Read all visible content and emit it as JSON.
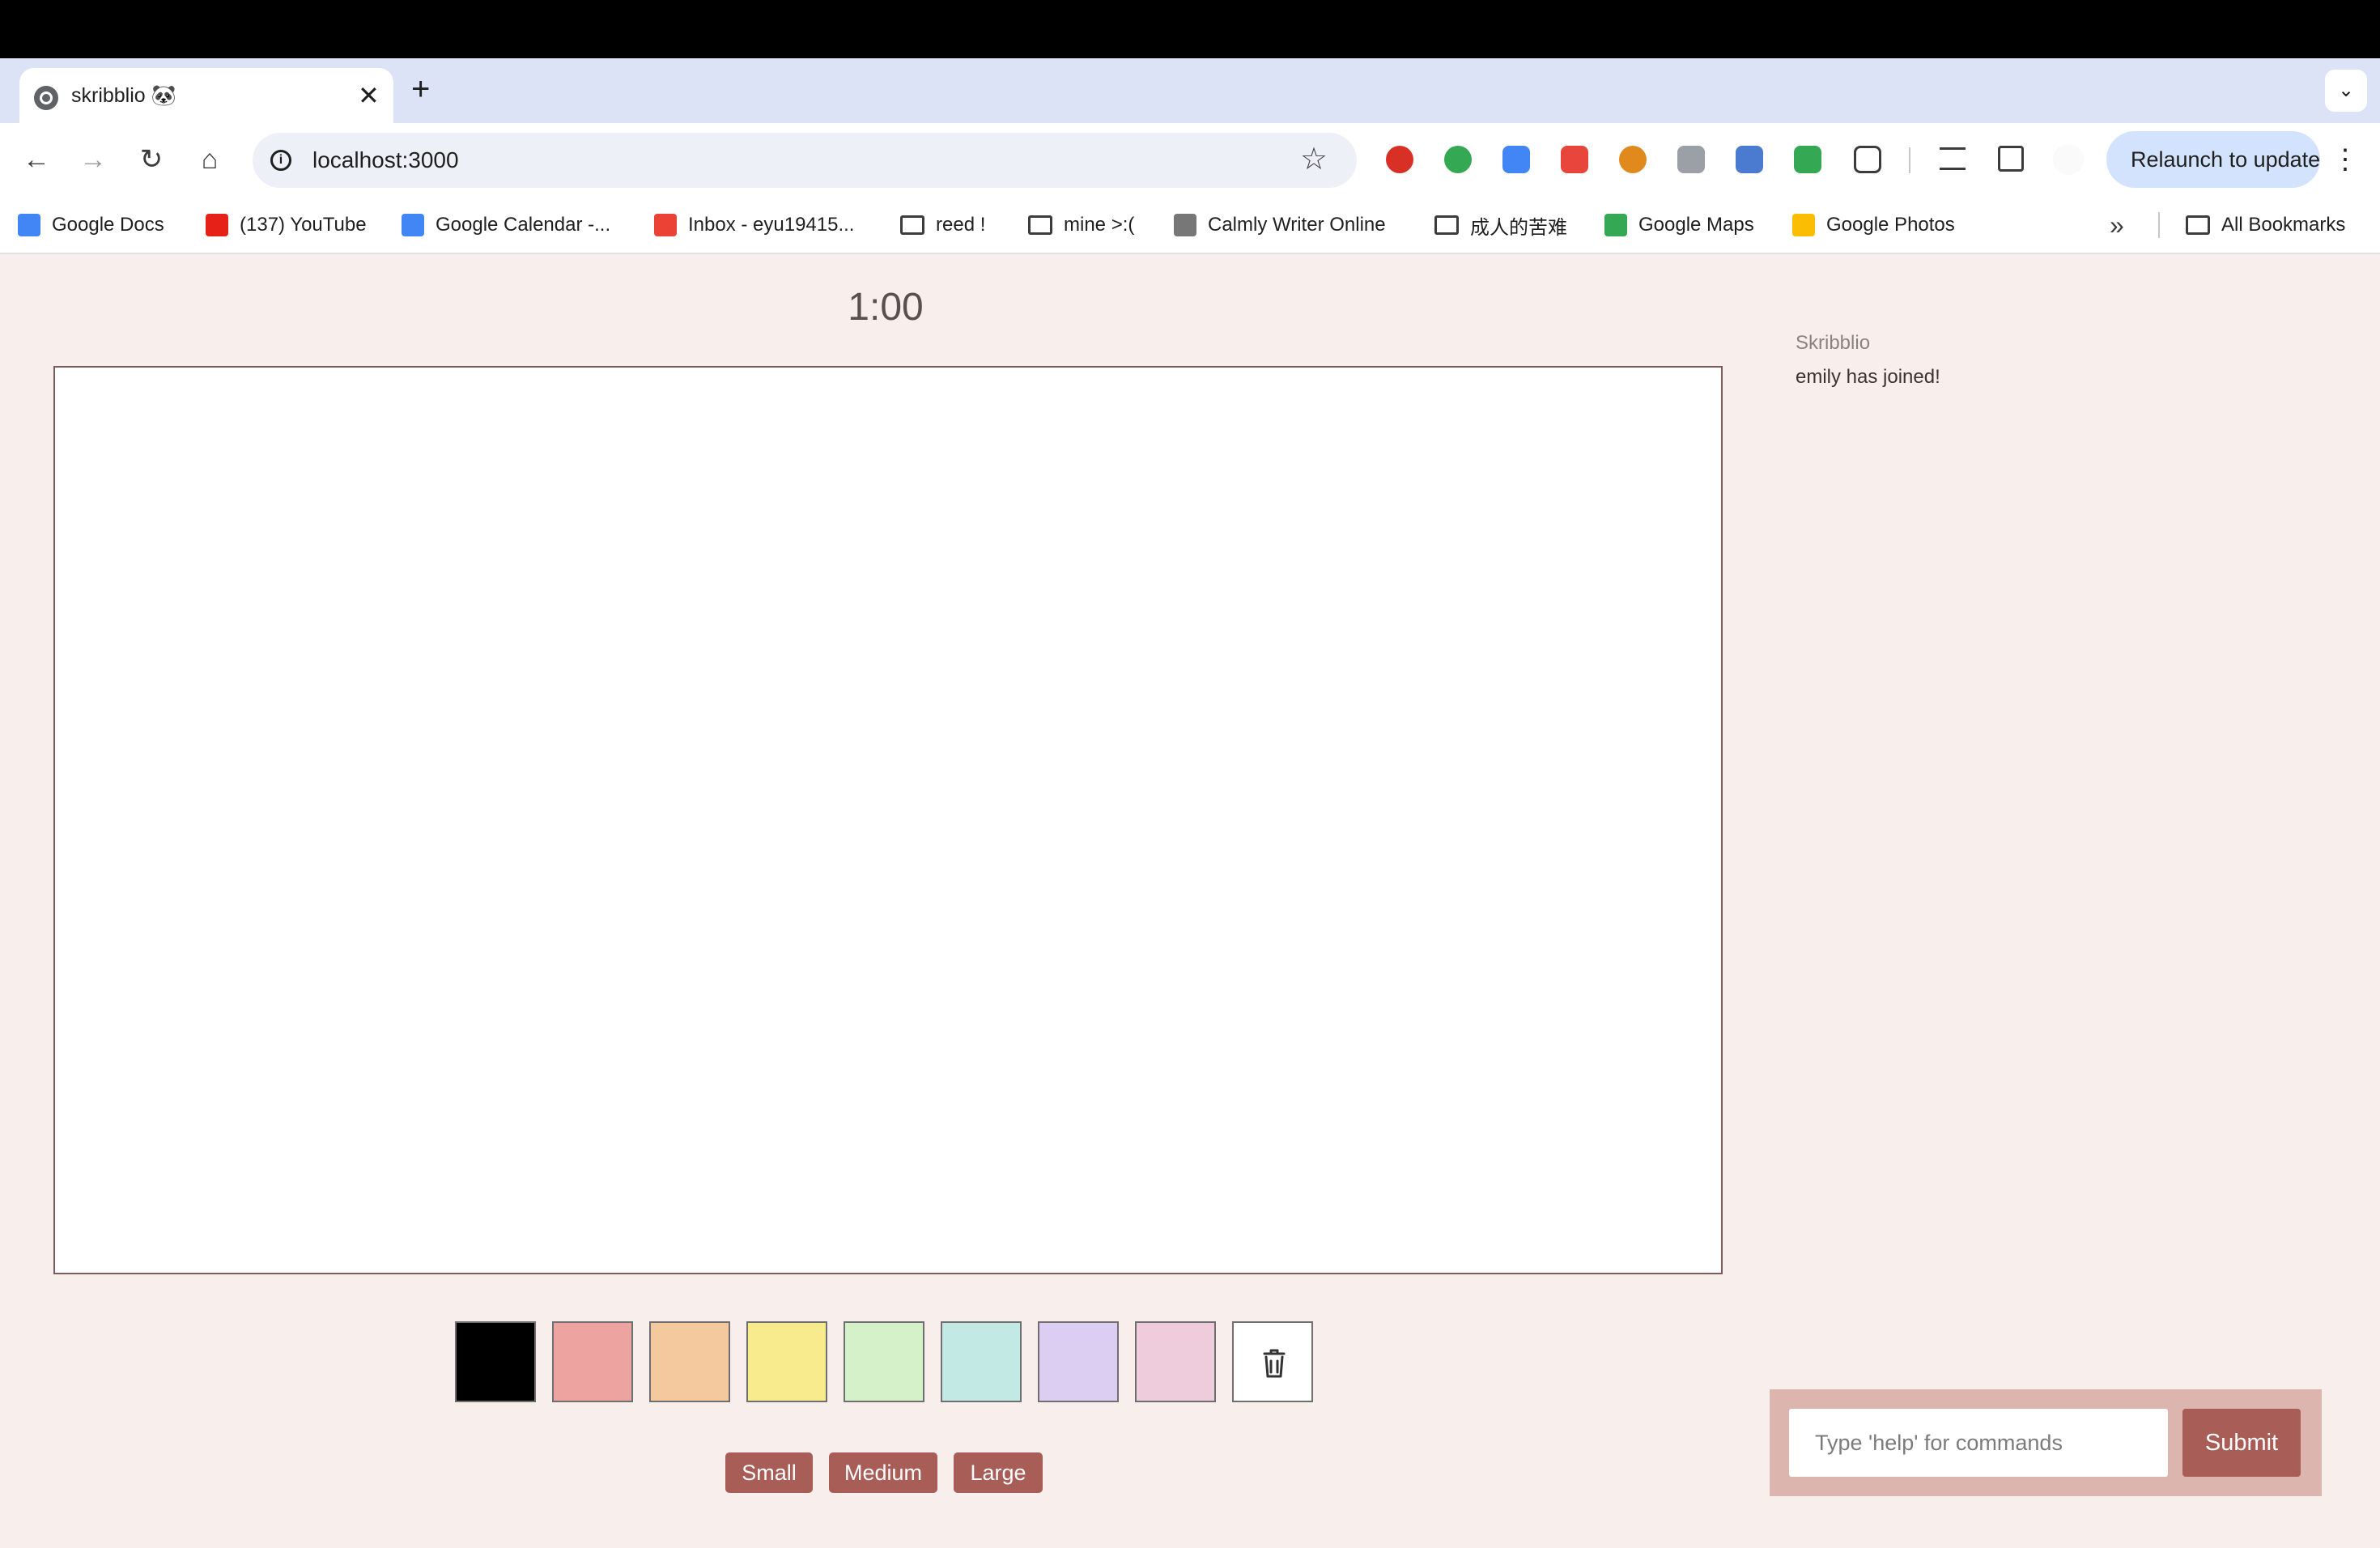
{
  "browser": {
    "tab_title": "skribblio 🐼",
    "new_tab": "+",
    "tab_close": "✕",
    "tab_menu": "⌄",
    "url": "localhost:3000",
    "relaunch_label": "Relaunch to update",
    "nav": {
      "back": "←",
      "forward": "→",
      "reload": "↻",
      "home": "⌂",
      "star": "☆",
      "menu": "⋮",
      "info": "i"
    },
    "extension_colors": [
      "#d93025",
      "#34a853",
      "#4285f4",
      "#e8453c",
      "#e08a1e",
      "#9aa0a6",
      "#4a7bd0",
      "#34a853",
      "#5f6368"
    ]
  },
  "bookmarks": {
    "items": [
      {
        "label": "Google Docs",
        "icon": "docs-icon",
        "color": "#4285f4"
      },
      {
        "label": "(137) YouTube",
        "icon": "youtube-icon",
        "color": "#e62117"
      },
      {
        "label": "Google Calendar -...",
        "icon": "calendar-icon",
        "color": "#4285f4"
      },
      {
        "label": "Inbox - eyu19415...",
        "icon": "gmail-icon",
        "color": "#ea4335"
      },
      {
        "label": "reed !",
        "icon": "folder-icon",
        "color": ""
      },
      {
        "label": "mine >:(",
        "icon": "folder-icon",
        "color": ""
      },
      {
        "label": "Calmly Writer Online",
        "icon": "calmly-icon",
        "color": "#777777"
      },
      {
        "label": "成人的苦难",
        "icon": "folder-icon",
        "color": ""
      },
      {
        "label": "Google Maps",
        "icon": "maps-icon",
        "color": "#34a853"
      },
      {
        "label": "Google Photos",
        "icon": "photos-icon",
        "color": "#fbbc04"
      }
    ],
    "more": "»",
    "all_bookmarks": "All Bookmarks"
  },
  "game": {
    "timer": "1:00",
    "palette": [
      "#000000",
      "#eda4a1",
      "#f5c99e",
      "#f8eb8e",
      "#d5f1c9",
      "#c3e9e4",
      "#dccdf2",
      "#efccdc"
    ],
    "sizes": [
      "Small",
      "Medium",
      "Large"
    ]
  },
  "chat": {
    "sender": "Skribblio",
    "message": "emily has joined!",
    "placeholder": "Type 'help' for commands",
    "submit": "Submit"
  },
  "colors": {
    "accent": "#a85d57",
    "page_bg": "#f8efec",
    "panel_bg": "#dcb5ae"
  }
}
